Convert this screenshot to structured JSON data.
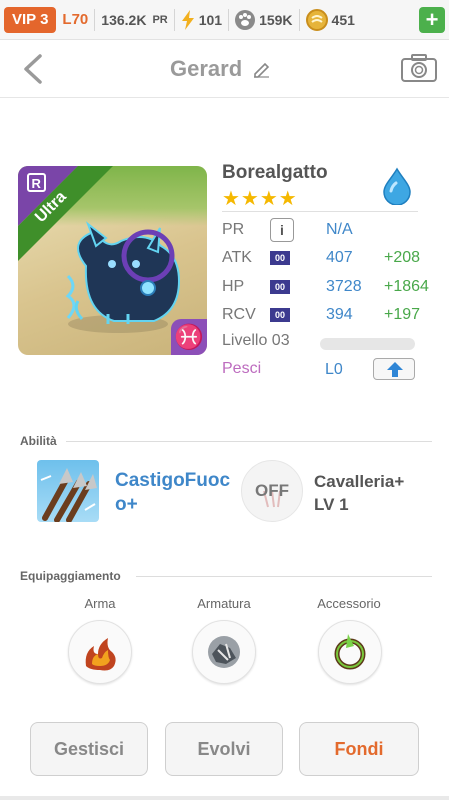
{
  "status": {
    "vip": "VIP 3",
    "level": "L70",
    "pr": "136.2K",
    "pr_suffix": "PR",
    "energy": "101",
    "paw": "159K",
    "coins": "451",
    "add_label": "+"
  },
  "header": {
    "title": "Gerard"
  },
  "monster": {
    "rarity": "Ultra",
    "name": "Borealgatto",
    "stars": "★★★★",
    "element_color": "#3ea7e3",
    "stats": {
      "pr": {
        "label": "PR",
        "value": "N/A"
      },
      "atk": {
        "label": "ATK",
        "tag": "00",
        "value": "407",
        "bonus": "+208"
      },
      "hp": {
        "label": "HP",
        "tag": "00",
        "value": "3728",
        "bonus": "+1864"
      },
      "rcv": {
        "label": "RCV",
        "tag": "00",
        "value": "394",
        "bonus": "+197"
      }
    },
    "level_label": "Livello 03",
    "level_progress": 0.0,
    "fish_label": "Pesci",
    "fish_value": "L0"
  },
  "abilities": {
    "section_title": "Abilità",
    "skill_line1": "CastigoFuoc",
    "skill_line2": "o+",
    "leader_status": "OFF",
    "leader_line1": "Cavalleria+",
    "leader_line2": "LV 1"
  },
  "equipment": {
    "section_title": "Equipaggiamento",
    "slots": [
      "Arma",
      "Armatura",
      "Accessorio"
    ]
  },
  "actions": {
    "manage": "Gestisci",
    "evolve": "Evolvi",
    "merge": "Fondi"
  }
}
